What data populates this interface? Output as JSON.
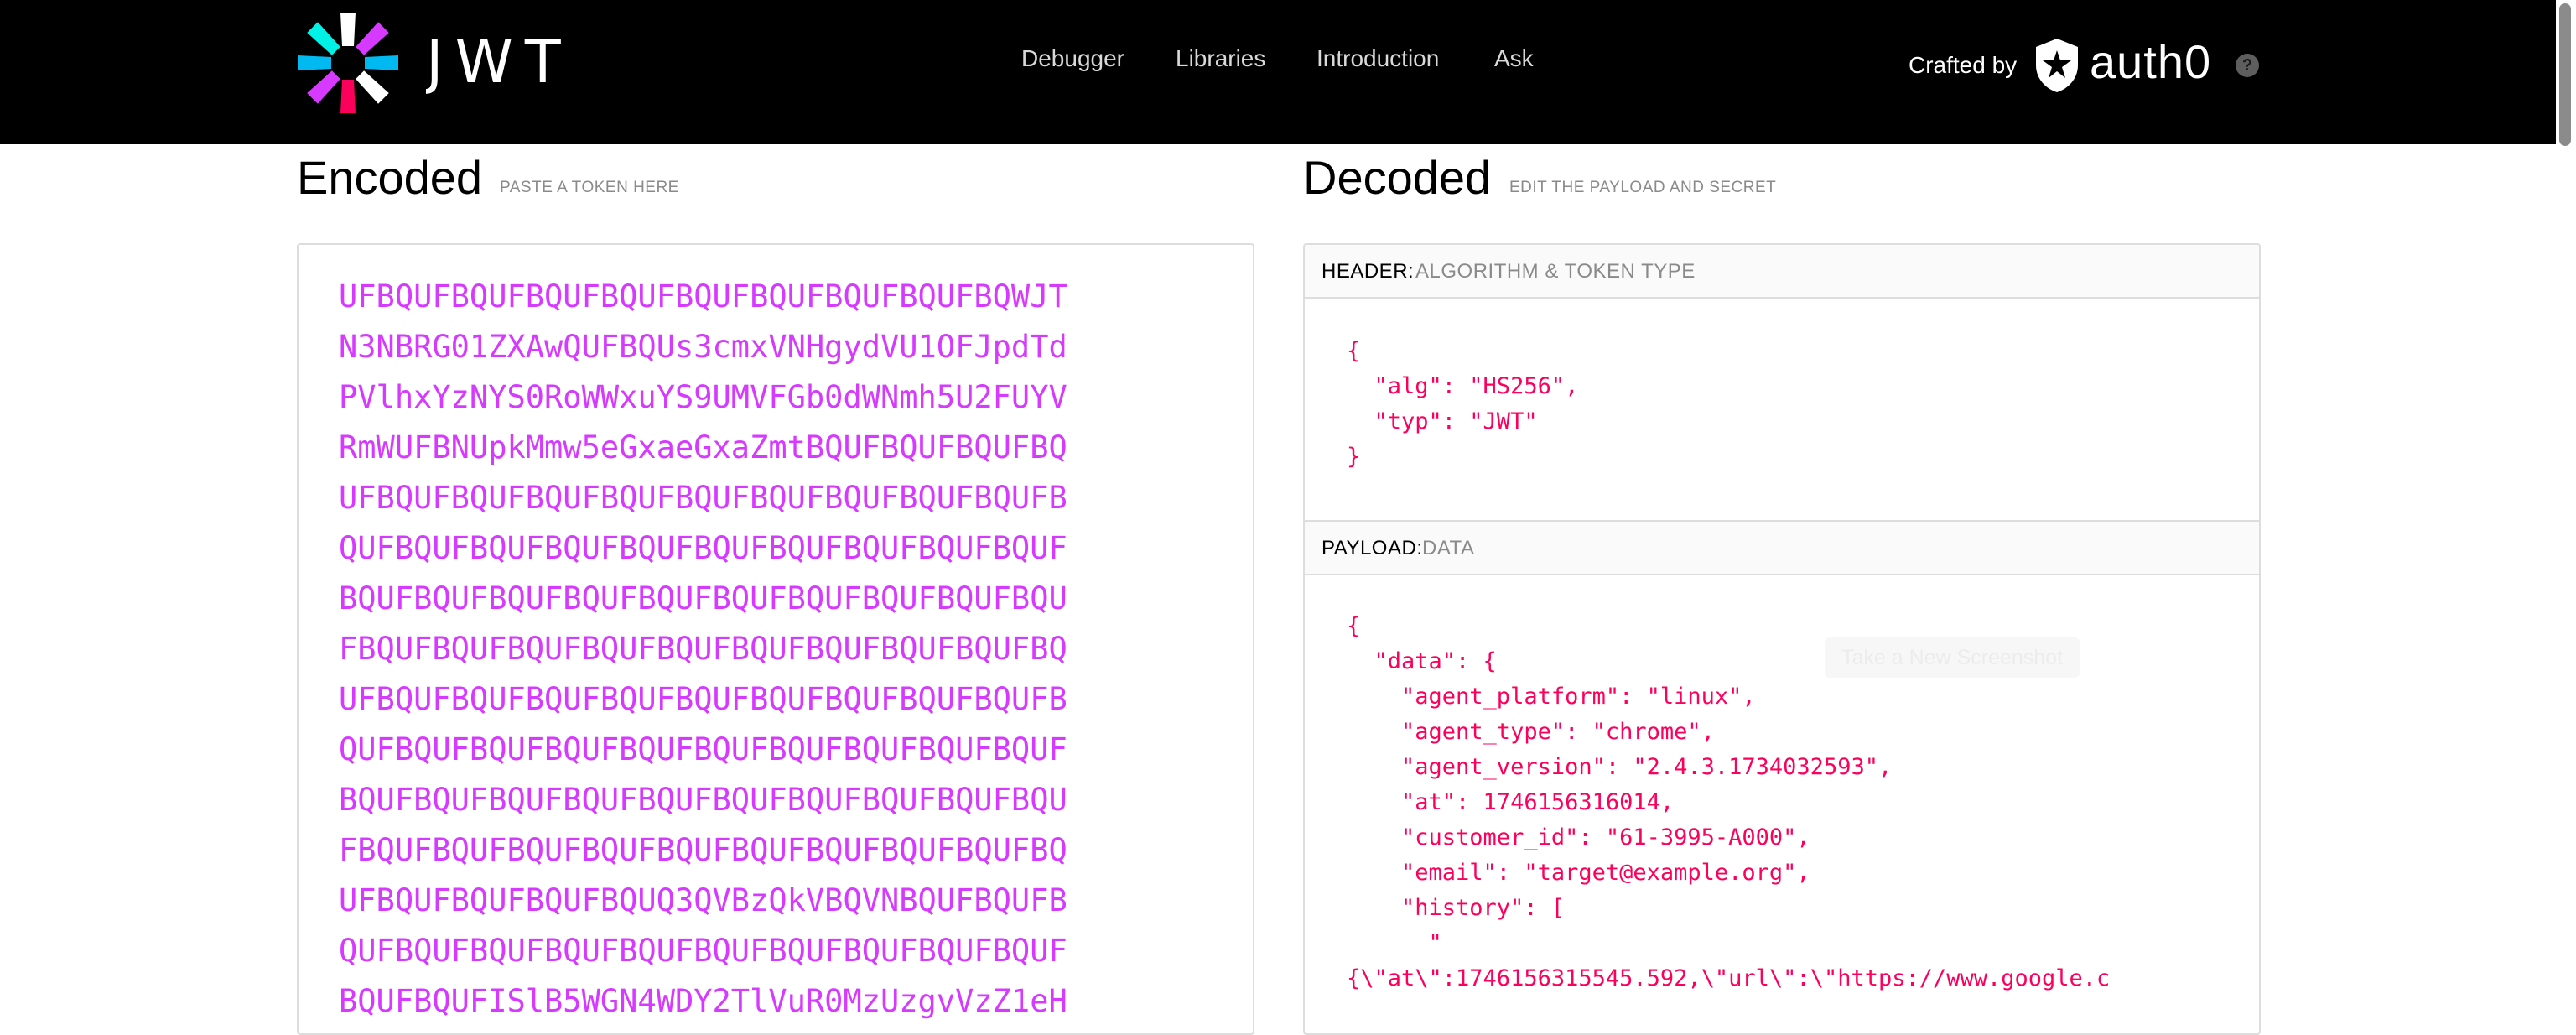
{
  "brand": {
    "wordmark": "JWT"
  },
  "nav": {
    "items": [
      {
        "label": "Debugger"
      },
      {
        "label": "Libraries"
      },
      {
        "label": "Introduction"
      },
      {
        "label": "Ask"
      }
    ]
  },
  "credits": {
    "crafted_by": "Crafted by",
    "auth0": "auth0",
    "help": "?"
  },
  "encoded": {
    "title": "Encoded",
    "subtitle": "PASTE A TOKEN HERE",
    "token_lines": [
      "UFBQUFBQUFBQUFBQUFBQUFBQUFBQUFBQUFBQWJT",
      "N3NBRG01ZXAwQUFBQUs3cmxVNHgydVU1OFJpdTd",
      "PVlhxYzNYS0RoWWxuYS9UMVFGb0dWNmh5U2FUYV",
      "RmWUFBNUpkMmw5eGxaeGxaZmtBQUFBQUFBQUFBQ",
      "UFBQUFBQUFBQUFBQUFBQUFBQUFBQUFBQUFBQUFB",
      "QUFBQUFBQUFBQUFBQUFBQUFBQUFBQUFBQUFBQUF",
      "BQUFBQUFBQUFBQUFBQUFBQUFBQUFBQUFBQUFBQU",
      "FBQUFBQUFBQUFBQUFBQUFBQUFBQUFBQUFBQUFBQ",
      "UFBQUFBQUFBQUFBQUFBQUFBQUFBQUFBQUFBQUFB",
      "QUFBQUFBQUFBQUFBQUFBQUFBQUFBQUFBQUFBQUF",
      "BQUFBQUFBQUFBQUFBQUFBQUFBQUFBQUFBQUFBQU",
      "FBQUFBQUFBQUFBQUFBQUFBQUFBQUFBQUFBQUFBQ",
      "UFBQUFBQUFBQUFBQUQ3QVBzQkVBQVNBQUFBQUFB",
      "QUFBQUFBQUFBQUFBQUFBQUFBQUFBQUFBQUFBQUF",
      "BQUFBQUFISlB5WGN4WDY2TlVuR0MzUzgvVzZ1eH"
    ]
  },
  "decoded": {
    "title": "Decoded",
    "subtitle": "EDIT THE PAYLOAD AND SECRET",
    "header": {
      "key": "HEADER:",
      "desc": "ALGORITHM & TOKEN TYPE",
      "lines": [
        "{",
        "  \"alg\": \"HS256\",",
        "  \"typ\": \"JWT\"",
        "}"
      ]
    },
    "payload": {
      "key": "PAYLOAD:",
      "desc": "DATA",
      "lines": [
        "{",
        "  \"data\": {",
        "    \"agent_platform\": \"linux\",",
        "    \"agent_type\": \"chrome\",",
        "    \"agent_version\": \"2.4.3.1734032593\",",
        "    \"at\": 1746156316014,",
        "    \"customer_id\": \"61-3995-A000\",",
        "    \"email\": \"target@example.org\",",
        "    \"history\": [",
        "      \"",
        "{\\\"at\\\":1746156315545.592,\\\"url\\\":\\\"https://www.google.c"
      ]
    }
  },
  "overlay": {
    "tooltip": "Take a New Screenshot"
  },
  "colors": {
    "token": "#d63aff",
    "json": "#fb015b",
    "topbar": "#000000"
  }
}
